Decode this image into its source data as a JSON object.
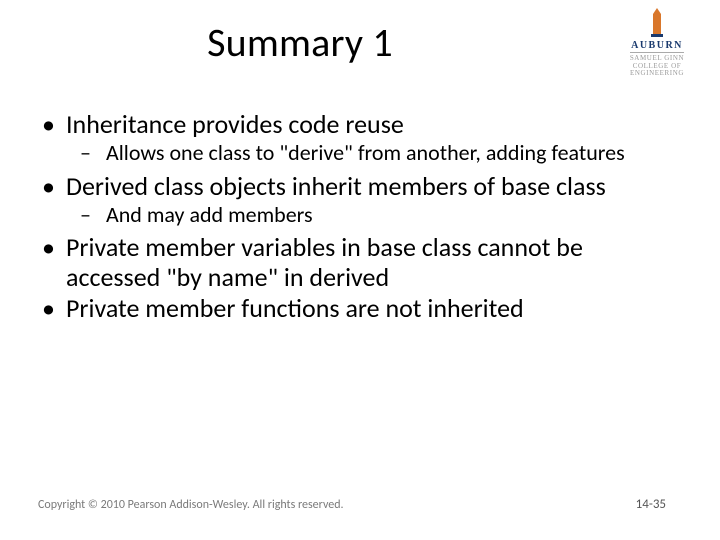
{
  "title": "Summary 1",
  "logo": {
    "university": "AUBURN",
    "college_line1": "SAMUEL GINN",
    "college_line2": "COLLEGE OF ENGINEERING"
  },
  "bullets": [
    {
      "text": "Inheritance provides code reuse",
      "sub": [
        "Allows one class to \"derive\" from another, adding features"
      ]
    },
    {
      "text": "Derived class objects inherit members of base class",
      "sub": [
        "And may add members"
      ]
    },
    {
      "text": "Private member variables in base class cannot be accessed \"by name\" in derived",
      "sub": []
    },
    {
      "text": "Private member functions are not inherited",
      "sub": []
    }
  ],
  "footer": {
    "copyright": "Copyright © 2010 Pearson Addison-Wesley. All rights reserved.",
    "page": "14-35"
  }
}
